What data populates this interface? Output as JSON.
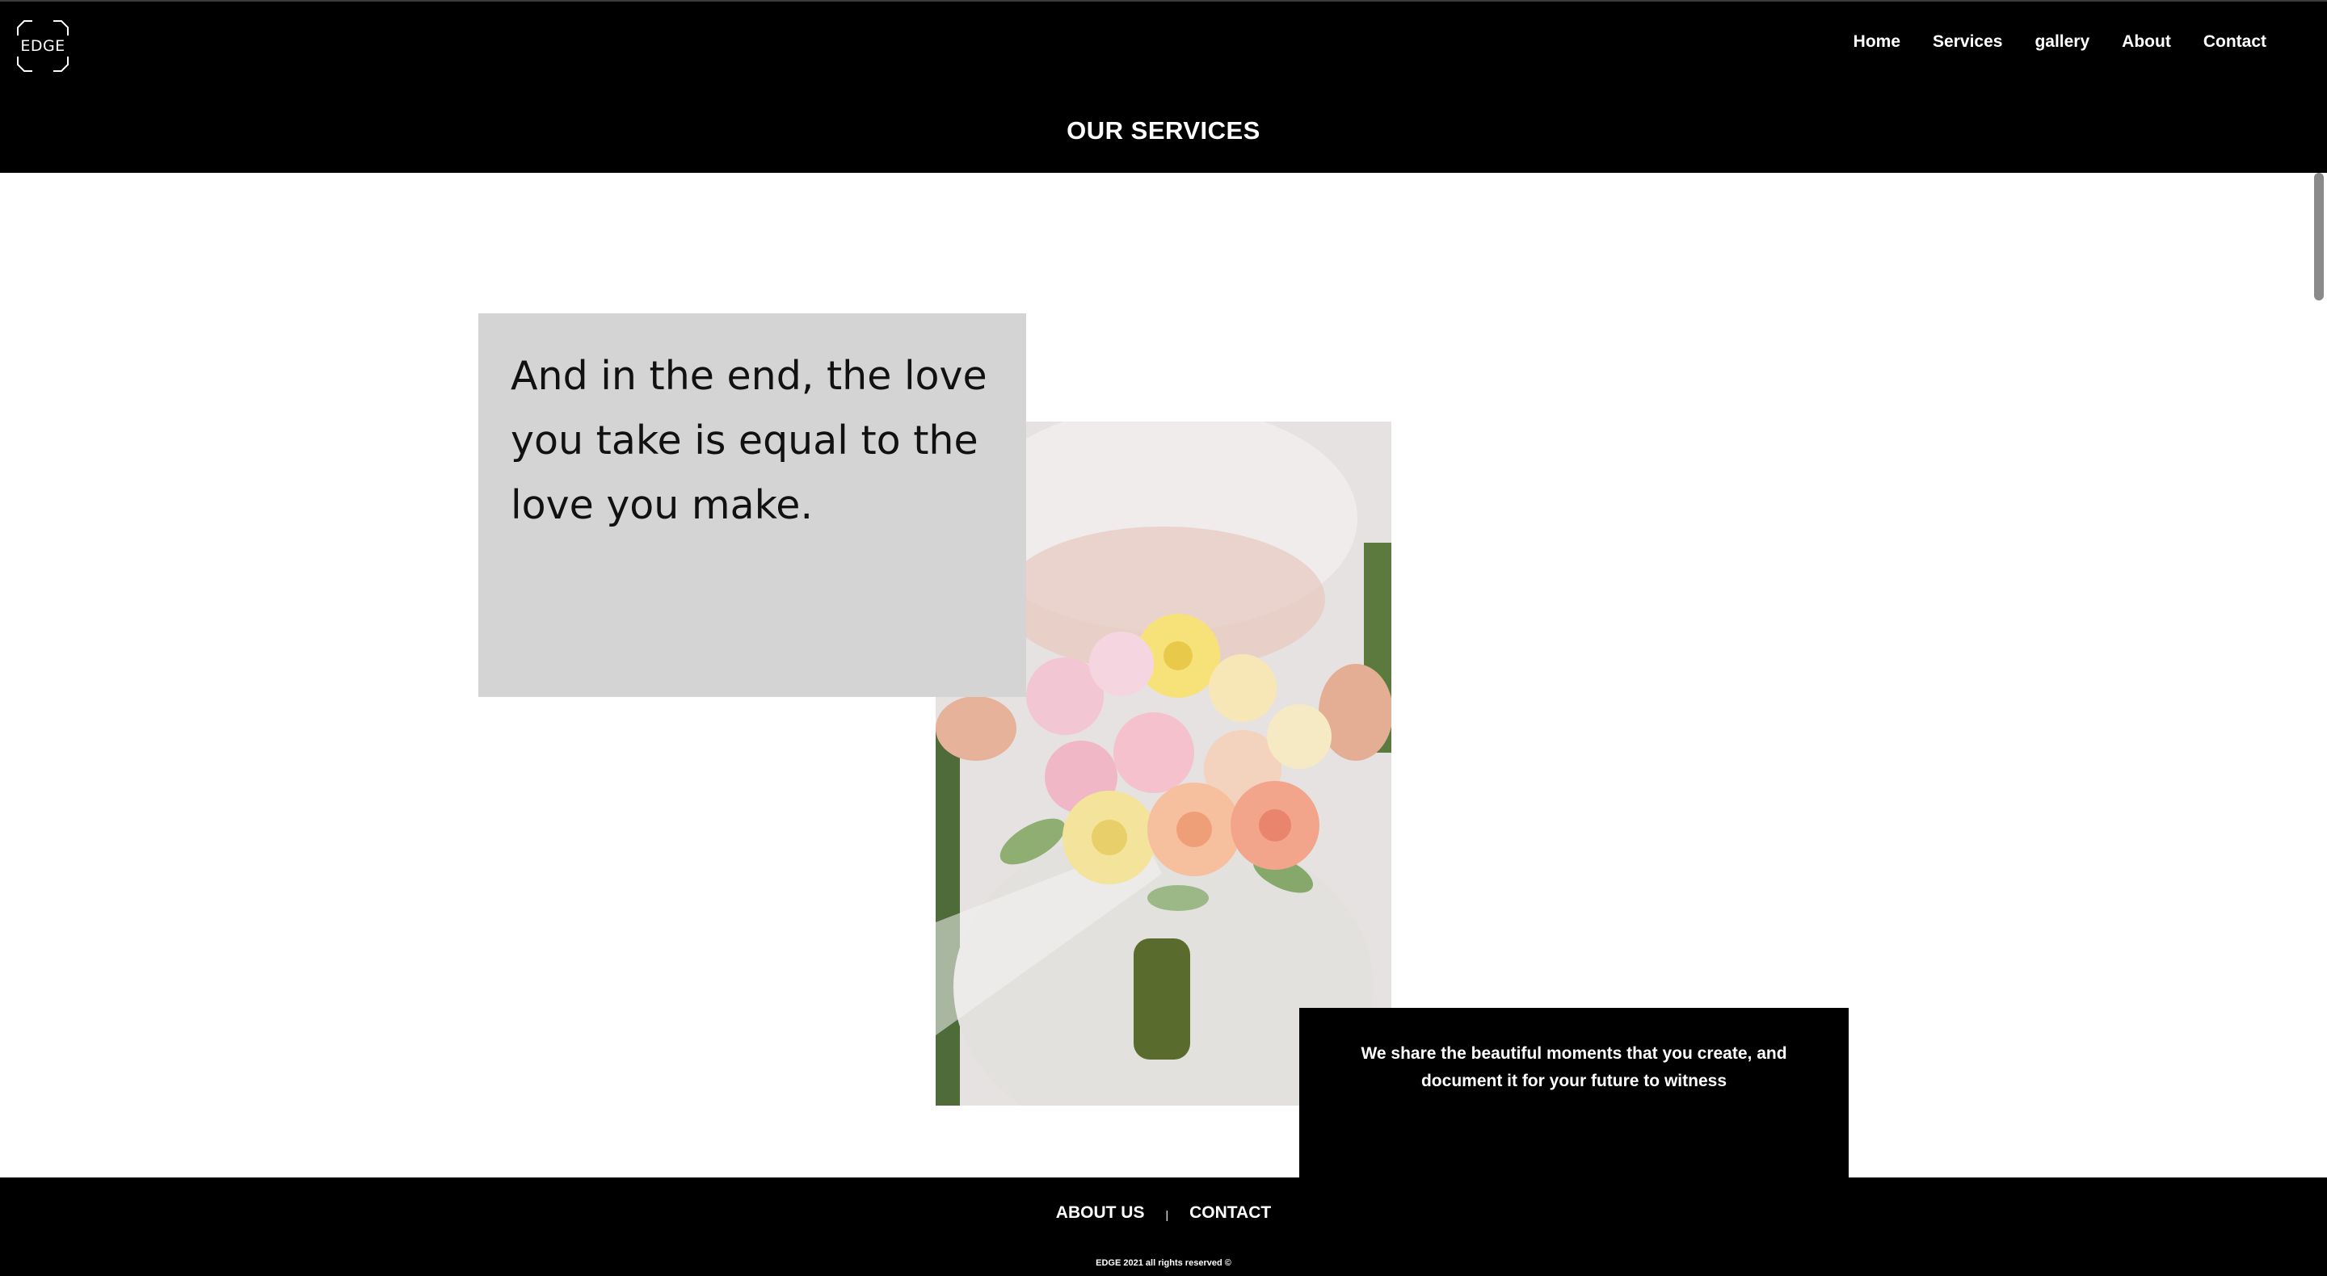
{
  "header": {
    "logo_text": "EDGE",
    "nav": [
      "Home",
      "Services",
      "gallery",
      "About",
      "Contact"
    ],
    "page_title": "OUR SERVICES"
  },
  "main": {
    "quote": "And in the end, the love you take is equal to the love you make.",
    "message": "We share the beautiful moments that you create, and document it for your future to witness"
  },
  "footer": {
    "links": [
      "ABOUT US",
      "CONTACT"
    ],
    "separator": "|",
    "copyright": "EDGE 2021 all rights reserved ©"
  }
}
